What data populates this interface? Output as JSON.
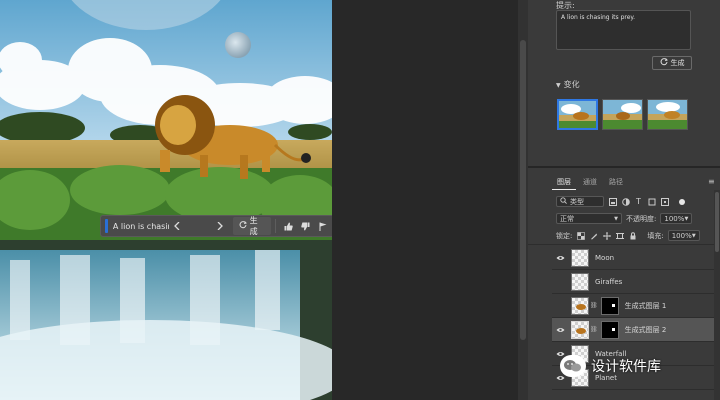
{
  "toolbar": {
    "prompt_text": "A lion is chasin...",
    "prev_icon": "chevron-left-icon",
    "next_icon": "chevron-right-icon",
    "generate_label": "生成",
    "thumbs_up_icon": "thumbs-up-icon",
    "thumbs_down_icon": "thumbs-down-icon",
    "flag_icon": "flag-icon",
    "more_icon": "more-icon"
  },
  "properties": {
    "prompt_label": "提示:",
    "prompt_value": "A lion is chasing its prey.",
    "generate_label": "生成",
    "variations_label": "变化",
    "selected_variation": 0
  },
  "layers_panel": {
    "tabs": [
      {
        "label": "图层",
        "active": true
      },
      {
        "label": "通道",
        "active": false
      },
      {
        "label": "路径",
        "active": false
      }
    ],
    "filter_kind": "类型",
    "blend_mode": "正常",
    "opacity_label": "不透明度:",
    "opacity_value": "100%",
    "lock_label": "锁定:",
    "fill_label": "填充:",
    "fill_value": "100%",
    "layers": [
      {
        "name": "Moon",
        "visible": true,
        "selected": false
      },
      {
        "name": "Giraffes",
        "visible": false,
        "selected": false
      },
      {
        "name": "生成式图层 1",
        "visible": false,
        "selected": false
      },
      {
        "name": "生成式图层 2",
        "visible": true,
        "selected": true
      },
      {
        "name": "Waterfall",
        "visible": true,
        "selected": false
      },
      {
        "name": "Planet",
        "visible": true,
        "selected": false
      }
    ]
  },
  "watermark": {
    "text": "设计软件库"
  },
  "colors": {
    "accent": "#2f78e3",
    "panel_bg": "#3a3a3a",
    "pasteboard": "#282828"
  }
}
